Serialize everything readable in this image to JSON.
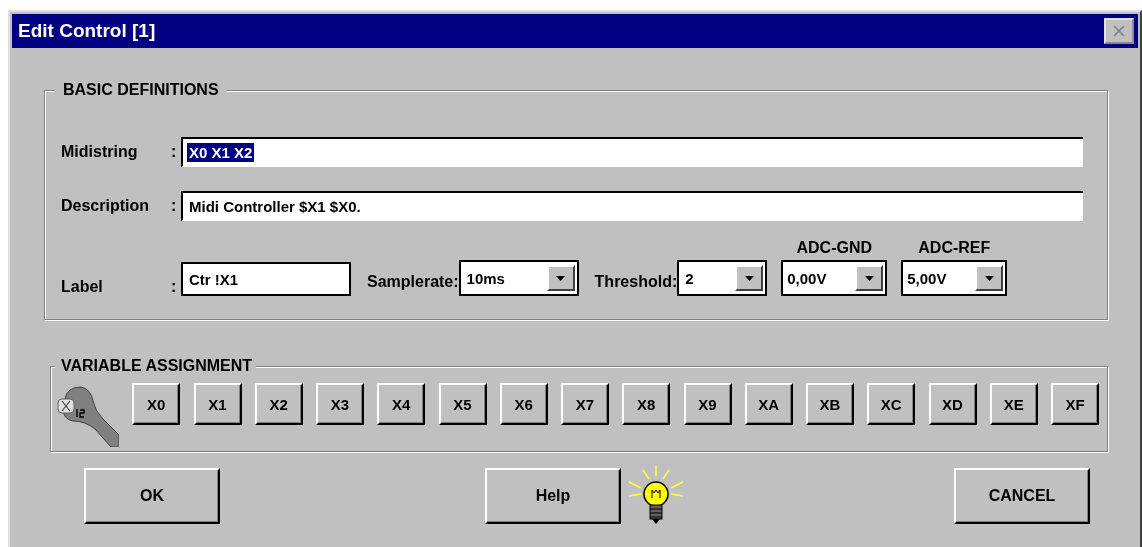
{
  "window": {
    "title": "Edit Control [1]",
    "close_disabled": true
  },
  "basic_definitions": {
    "title": "BASIC DEFINITIONS",
    "fields": [
      {
        "label": "Midistring",
        "separator": ":",
        "value": "X0 X1 X2",
        "highlighted": true
      },
      {
        "label": "Description",
        "separator": ":",
        "value": "Midi Controller $X1 $X0.",
        "highlighted": false
      }
    ],
    "label_field": {
      "label": "Label",
      "separator": ":",
      "value": "Ctr !X1"
    },
    "dropdowns": [
      {
        "label": "Samplerate:",
        "value": "10ms",
        "kind": "inline"
      },
      {
        "label": "Threshold:",
        "value": "2",
        "kind": "inline"
      },
      {
        "label": "ADC-GND",
        "value": "0,00V",
        "kind": "stacked"
      },
      {
        "label": "ADC-REF",
        "value": "5,00V",
        "kind": "stacked"
      }
    ]
  },
  "variable_assignment": {
    "title": "VARIABLE ASSIGNMENT",
    "buttons": [
      "X0",
      "X1",
      "X2",
      "X3",
      "X4",
      "X5",
      "X6",
      "X7",
      "X8",
      "X9",
      "XA",
      "XB",
      "XC",
      "XD",
      "XE",
      "XF"
    ]
  },
  "buttons": {
    "ok": "OK",
    "help": "Help",
    "cancel": "CANCEL"
  }
}
